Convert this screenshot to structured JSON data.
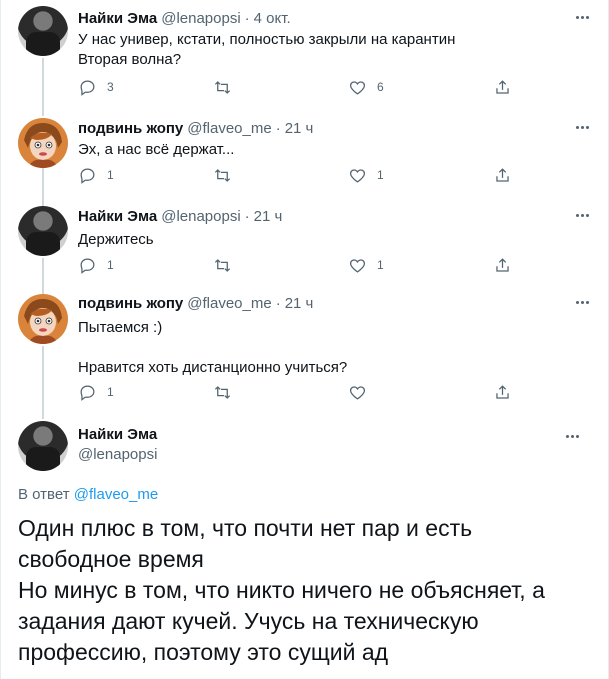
{
  "tweets": [
    {
      "name": "Найки Эма",
      "handle": "@lenapopsi",
      "time": "4 окт.",
      "lines": [
        "У нас универ, кстати, полностью закрыли на карантин",
        "Вторая волна?"
      ],
      "replies": "3",
      "retweets": "",
      "likes": "6",
      "avatar": "dark-figure-photo"
    },
    {
      "name": "подвинь жопу",
      "handle": "@flaveo_me",
      "time": "21 ч",
      "lines": [
        "Эх, а нас всё держат..."
      ],
      "replies": "1",
      "retweets": "",
      "likes": "1",
      "avatar": "cartoon-redhead"
    },
    {
      "name": "Найки Эма",
      "handle": "@lenapopsi",
      "time": "21 ч",
      "lines": [
        "Держитесь"
      ],
      "replies": "1",
      "retweets": "",
      "likes": "1",
      "avatar": "dark-figure-photo"
    },
    {
      "name": "подвинь жопу",
      "handle": "@flaveo_me",
      "time": "21 ч",
      "lines": [
        "Пытаемся :)",
        "Нравится хоть дистанционно учиться?"
      ],
      "replies": "1",
      "retweets": "",
      "likes": "",
      "avatar": "cartoon-redhead"
    }
  ],
  "main": {
    "name": "Найки Эма",
    "handle": "@lenapopsi",
    "reply_prefix": "В ответ",
    "reply_handle": "@flaveo_me",
    "text_lines": [
      "Один плюс в том, что почти нет пар и есть",
      "свободное время",
      "Но минус в том, что никто ничего не объясняет, а",
      "задания дают кучей. Учусь на техническую",
      "профессию, поэтому это сущий ад"
    ]
  },
  "separator": "·",
  "colors": {
    "text": "#0f1419",
    "secondary": "#536471",
    "link": "#1d9bf0",
    "thread_line": "#cfd9de"
  }
}
